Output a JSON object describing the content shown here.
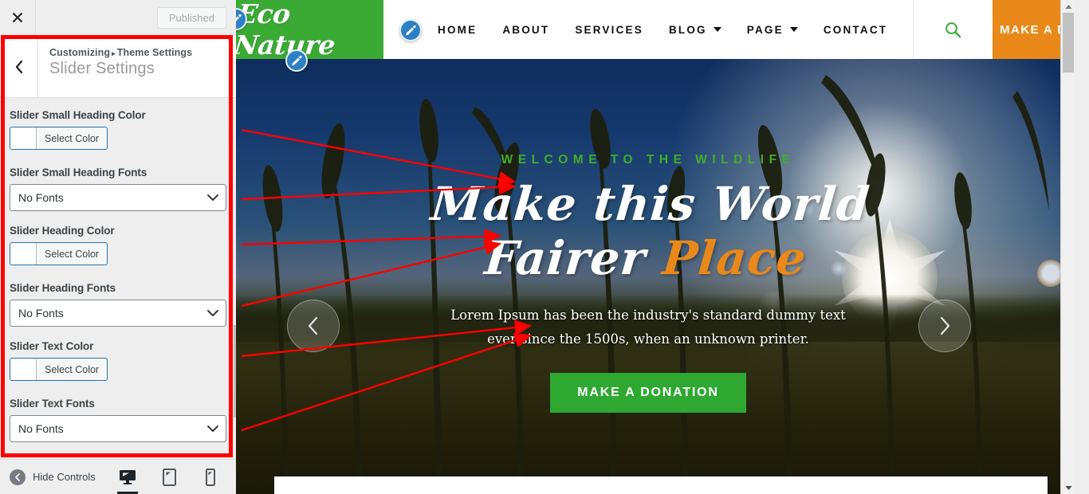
{
  "customizer": {
    "close_icon": "close-x-icon",
    "publish_label": "Published",
    "back_icon": "chevron-left-icon",
    "breadcrumb_root": "Customizing",
    "breadcrumb_sep": "▸",
    "breadcrumb_parent": "Theme Settings",
    "panel_title": "Slider Settings",
    "controls": [
      {
        "label": "Slider Small Heading Color",
        "type": "color",
        "value": "Select Color",
        "swatch": "#ffffff"
      },
      {
        "label": "Slider Small Heading Fonts",
        "type": "select",
        "value": "No Fonts"
      },
      {
        "label": "Slider Heading Color",
        "type": "color",
        "value": "Select Color",
        "swatch": "#ffffff"
      },
      {
        "label": "Slider Heading Fonts",
        "type": "select",
        "value": "No Fonts"
      },
      {
        "label": "Slider Text Color",
        "type": "color",
        "value": "Select Color",
        "swatch": "#ffffff"
      },
      {
        "label": "Slider Text Fonts",
        "type": "select",
        "value": "No Fonts"
      }
    ],
    "footer": {
      "hide_label": "Hide Controls",
      "hide_icon": "chevron-left-circle-icon",
      "devices": [
        {
          "name": "desktop",
          "icon": "desktop-icon",
          "active": true
        },
        {
          "name": "tablet",
          "icon": "tablet-icon",
          "active": false
        },
        {
          "name": "mobile",
          "icon": "mobile-icon",
          "active": false
        }
      ]
    }
  },
  "preview": {
    "header": {
      "logo": "Eco Nature",
      "logo_bg": "#3aaa35",
      "menu": [
        {
          "label": "HOME",
          "has_dropdown": false
        },
        {
          "label": "ABOUT",
          "has_dropdown": false
        },
        {
          "label": "SERVICES",
          "has_dropdown": false
        },
        {
          "label": "BLOG",
          "has_dropdown": true
        },
        {
          "label": "PAGE",
          "has_dropdown": true
        },
        {
          "label": "CONTACT",
          "has_dropdown": false
        }
      ],
      "search_icon": "search-icon",
      "search_color": "#3aaa35",
      "donate_label": "MAKE A DONATION",
      "donate_bg": "#e8891a"
    },
    "hero": {
      "small_heading": "WELCOME TO THE WILDLIFE",
      "small_heading_color": "#3fae2a",
      "heading_line1": "Make this World",
      "heading_line2_white": "Fairer ",
      "heading_line2_accent": "Place",
      "heading_color": "#ffffff",
      "accent_color": "#e8891a",
      "text_line1": "Lorem Ipsum has been the industry's standard dummy text",
      "text_line2": "ever since the 1500s, when an unknown printer.",
      "text_color": "#ffffff",
      "button_label": "MAKE A DONATION",
      "button_bg": "#2fa832",
      "prev_icon": "chevron-left-icon",
      "next_icon": "chevron-right-icon"
    },
    "edit_pencils": [
      {
        "name": "edit-logo-pencil",
        "icon": "pencil-icon"
      },
      {
        "name": "edit-menu-pencil",
        "icon": "pencil-icon"
      },
      {
        "name": "edit-hero-pencil",
        "icon": "pencil-icon"
      }
    ]
  },
  "annotation": {
    "box_color": "#ff0000",
    "arrow_color": "#ff0000",
    "arrows": [
      {
        "from": "slider-small-heading-color",
        "to": "hero-small-heading"
      },
      {
        "from": "slider-small-heading-fonts",
        "to": "hero-small-heading"
      },
      {
        "from": "slider-heading-color",
        "to": "hero-heading"
      },
      {
        "from": "slider-heading-fonts",
        "to": "hero-heading"
      },
      {
        "from": "slider-text-color",
        "to": "hero-text"
      },
      {
        "from": "slider-text-fonts",
        "to": "hero-text"
      }
    ]
  }
}
